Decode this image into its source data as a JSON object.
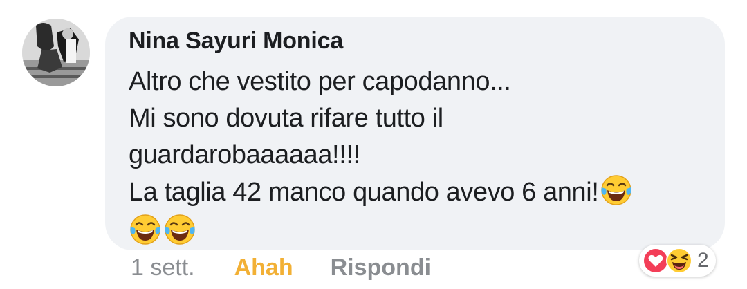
{
  "comment": {
    "author": "Nina Sayuri Monica",
    "lines": [
      "Altro che vestito per capodanno...",
      "Mi sono dovuta rifare tutto il",
      "guardarobaaaaaa!!!!",
      "La taglia 42 manco quando avevo 6 anni!"
    ],
    "inline_emoji": "face-with-tears-of-joy-icon",
    "trailing_emojis": [
      "face-with-tears-of-joy-icon",
      "face-with-tears-of-joy-icon"
    ]
  },
  "actions": {
    "time": "1 sett.",
    "reaction_label": "Ahah",
    "reply_label": "Rispondi"
  },
  "reactions": {
    "icons": [
      "heart-icon",
      "laughing-face-icon"
    ],
    "count": "2"
  },
  "colors": {
    "bubble": "#f0f2f5",
    "text": "#1c1e21",
    "meta": "#8a8d91",
    "reacted": "#f2b035",
    "heart": "#f33e58"
  }
}
